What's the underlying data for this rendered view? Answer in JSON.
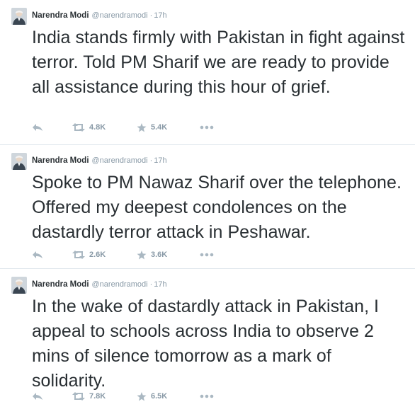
{
  "colors": {
    "text": "#292f33",
    "muted": "#8899a6",
    "icon": "#aab8c2",
    "divider": "#e1e8ed"
  },
  "icons": {
    "reply": "reply-icon",
    "retweet": "retweet-icon",
    "favorite": "star-icon",
    "more": "more-icon"
  },
  "tweets": [
    {
      "author_name": "Narendra Modi",
      "handle": "@narendramodi",
      "separator": "·",
      "time": "17h",
      "text": "India stands firmly with Pakistan in fight against terror. Told PM Sharif we are ready to provide all assistance during this hour of grief.",
      "retweets": "4.8K",
      "favorites": "5.4K"
    },
    {
      "author_name": "Narendra Modi",
      "handle": "@narendramodi",
      "separator": "·",
      "time": "17h",
      "text": "Spoke to PM Nawaz Sharif over the telephone. Offered my deepest condolences on the dastardly terror attack in Peshawar.",
      "retweets": "2.6K",
      "favorites": "3.6K"
    },
    {
      "author_name": "Narendra Modi",
      "handle": "@narendramodi",
      "separator": "·",
      "time": "17h",
      "text": "In the wake of dastardly attack in Pakistan, I appeal to schools across India to observe 2 mins of silence tomorrow as a mark of solidarity.",
      "retweets": "7.8K",
      "favorites": "6.5K"
    }
  ]
}
